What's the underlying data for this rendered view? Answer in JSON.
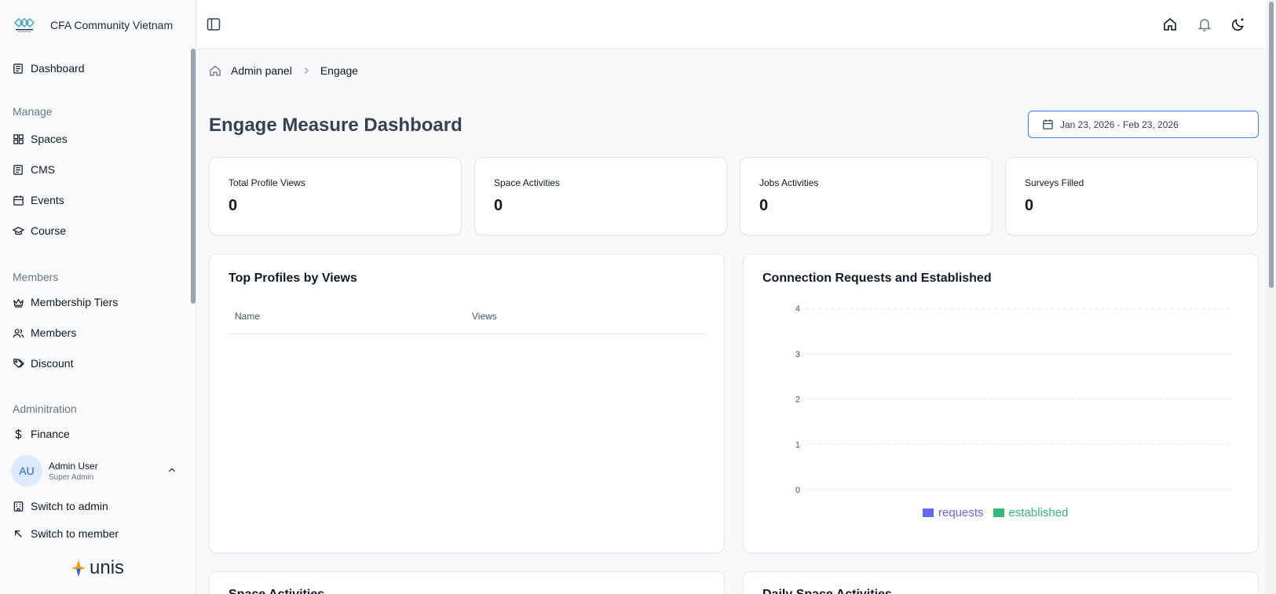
{
  "brand": {
    "name": "CFA Community Vietnam"
  },
  "sidebar": {
    "dashboard": "Dashboard",
    "manage_label": "Manage",
    "manage_items": [
      {
        "label": "Spaces",
        "icon": "grid-icon"
      },
      {
        "label": "CMS",
        "icon": "newspaper-icon"
      },
      {
        "label": "Events",
        "icon": "calendar-icon"
      },
      {
        "label": "Course",
        "icon": "graduation-cap-icon"
      }
    ],
    "members_label": "Members",
    "members_items": [
      {
        "label": "Membership Tiers",
        "icon": "crown-icon"
      },
      {
        "label": "Members",
        "icon": "users-icon"
      },
      {
        "label": "Discount",
        "icon": "tags-icon"
      }
    ],
    "admin_label": "Adminitration",
    "admin_items": [
      {
        "label": "Finance",
        "icon": "dollar-icon"
      }
    ],
    "user": {
      "initials": "AU",
      "name": "Admin User",
      "role": "Super Admin"
    },
    "switch_admin": "Switch to admin",
    "switch_member": "Switch to member",
    "footer_logo": "unis"
  },
  "breadcrumb": {
    "root": "Admin panel",
    "current": "Engage"
  },
  "page": {
    "title": "Engage Measure Dashboard",
    "date_range": "Jan 23, 2026 - Feb 23, 2026"
  },
  "stats": [
    {
      "label": "Total Profile Views",
      "value": "0"
    },
    {
      "label": "Space Activities",
      "value": "0"
    },
    {
      "label": "Jobs Activities",
      "value": "0"
    },
    {
      "label": "Surveys Filled",
      "value": "0"
    }
  ],
  "top_profiles": {
    "title": "Top Profiles by Views",
    "columns": [
      "Name",
      "Views"
    ],
    "rows": []
  },
  "connections": {
    "title": "Connection Requests and Established"
  },
  "chart_data": {
    "type": "bar",
    "title": "Connection Requests and Established",
    "categories": [],
    "series": [
      {
        "name": "requests",
        "values": []
      },
      {
        "name": "established",
        "values": []
      }
    ],
    "ylim": [
      0,
      4
    ],
    "yticks": [
      "0",
      "1",
      "2",
      "3",
      "4"
    ],
    "grid": true,
    "legend": "bottom-center",
    "colors": {
      "requests": "#6366f1",
      "established": "#34b97a"
    }
  },
  "lower_panels": {
    "left_title": "Space Activities",
    "right_title": "Daily Space Activities"
  },
  "colors": {
    "accent": "#3b82f6",
    "avatar_bg": "#dbeafe",
    "avatar_fg": "#2563eb"
  }
}
